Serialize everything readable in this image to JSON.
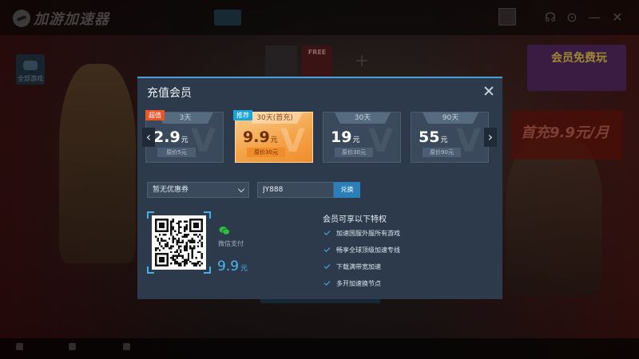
{
  "app": {
    "logo_text": "加游加速器",
    "side_game_label": "全部游戏",
    "free_tile_text": "FREE",
    "promo_text": "会员免费玩",
    "bg_card_text": "首充9.9元/月",
    "bottom_items": [
      "",
      ""
    ]
  },
  "modal": {
    "title": "充值会员",
    "plans": [
      {
        "duration": "3天",
        "price": "2.9",
        "unit": "元",
        "original": "原价5元",
        "tag": "超值",
        "selected": false
      },
      {
        "duration": "30天(首充)",
        "price": "9.9",
        "unit": "元",
        "original": "原价30元",
        "tag": "推荐",
        "selected": true
      },
      {
        "duration": "30天",
        "price": "19",
        "unit": "元",
        "original": "原价30元",
        "tag": "",
        "selected": false
      },
      {
        "duration": "90天",
        "price": "55",
        "unit": "元",
        "original": "原价90元",
        "tag": "",
        "selected": false
      }
    ],
    "prev_arrow": "‹",
    "next_arrow": "›",
    "coupon": {
      "value": "暂无优惠券"
    },
    "code": {
      "value": "JY888",
      "button": "兑换"
    },
    "payment": {
      "method": "微信支付",
      "amount": "9.9",
      "unit": "元"
    },
    "benefits": {
      "title": "会员可享以下特权",
      "items": [
        "加速国服外服所有游戏",
        "畅享全球顶级加速专线",
        "下载满带宽加速",
        "多开加速换节点"
      ]
    }
  },
  "colors": {
    "accent": "#4ab0e8",
    "selected_plan": "#f4a44a",
    "tag_red": "#e8562a",
    "tag_blue": "#1aa3d6"
  }
}
